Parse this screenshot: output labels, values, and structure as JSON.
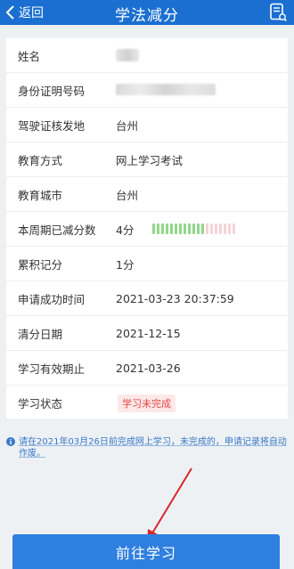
{
  "header": {
    "back_label": "返回",
    "title": "学法减分"
  },
  "fields": [
    {
      "label": "姓名",
      "value": ""
    },
    {
      "label": "身份证明号码",
      "value": ""
    },
    {
      "label": "驾驶证核发地",
      "value": "台州"
    },
    {
      "label": "教育方式",
      "value": "网上学习考试"
    },
    {
      "label": "教育城市",
      "value": "台州"
    },
    {
      "label": "本周期已减分数",
      "value": "4分"
    },
    {
      "label": "累积记分",
      "value": "1分"
    },
    {
      "label": "申请成功时间",
      "value": "2021-03-23 20:37:59"
    },
    {
      "label": "清分日期",
      "value": "2021-12-15"
    },
    {
      "label": "学习有效期止",
      "value": "2021-03-26"
    },
    {
      "label": "学习状态",
      "value": "学习未完成"
    }
  ],
  "progress": {
    "filled": 12,
    "total": 19,
    "filled_color": "#8fd88a",
    "empty_color": "#f4d3d6"
  },
  "notice": "请在2021年03月26日前完成网上学习，未完成的，申请记录将自动作废。",
  "cta_label": "前往学习",
  "colors": {
    "header": "#1a6fd0",
    "button": "#2f7fe0",
    "status": "#e04848"
  }
}
